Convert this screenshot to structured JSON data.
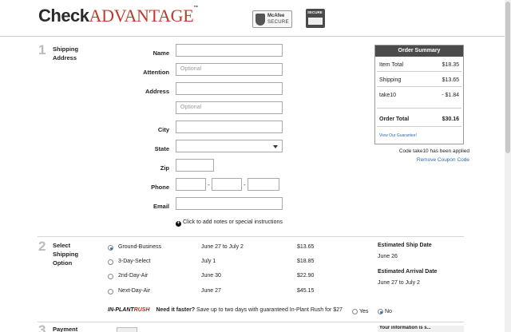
{
  "header": {
    "logo_check": "Check",
    "logo_advantage": "ADVANTAGE",
    "logo_tm": "™",
    "mcafee_line1": "McAfee",
    "mcafee_line2": "SECURE",
    "secure_badge": "SECURE"
  },
  "steps": {
    "s1_num": "1",
    "s1_label_a": "Shipping",
    "s1_label_b": "Address",
    "s2_num": "2",
    "s2_label_a": "Select",
    "s2_label_b": "Shipping",
    "s2_label_c": "Option",
    "s3_num": "3",
    "s3_label": "Payment"
  },
  "form": {
    "name_label": "Name",
    "attention_label": "Attention",
    "attention_placeholder": "Optional",
    "address_label": "Address",
    "address2_placeholder": "Optional",
    "city_label": "City",
    "state_label": "State",
    "zip_label": "Zip",
    "phone_label": "Phone",
    "phone_sep": "-",
    "email_label": "Email",
    "add_notes": "Click to add notes or special instructions"
  },
  "summary": {
    "title": "Order Summary",
    "item_total_label": "Item Total",
    "item_total": "$18.35",
    "shipping_label": "Shipping",
    "shipping": "$13.65",
    "coupon_label": "take10",
    "coupon": "- $1.84",
    "order_total_label": "Order Total",
    "order_total": "$30.16",
    "guarantee_link": "View Our Guarantee!",
    "coupon_msg": "Code take10 has been applied",
    "remove_coupon": "Remove Coupon Code"
  },
  "shipping_options": [
    {
      "method": "Ground-Business",
      "date": "June 27 to July 2",
      "price": "$13.65",
      "selected": true
    },
    {
      "method": "3-Day-Select",
      "date": "July 1",
      "price": "$18.85",
      "selected": false
    },
    {
      "method": "2nd-Day-Air",
      "date": "June 30",
      "price": "$22.90",
      "selected": false
    },
    {
      "method": "Next-Day-Air",
      "date": "June 27",
      "price": "$45.15",
      "selected": false
    }
  ],
  "estimates": {
    "ship_label": "Estimated Ship Date",
    "ship_date": "June 26",
    "arrival_label": "Estimated Arrival Date",
    "arrival_date": "June 27 to July 2"
  },
  "rush": {
    "logo_a": "IN-PLANT",
    "logo_b": "RUSH",
    "question": "Need it faster?",
    "text": "Save up to two days with guaranteed In-Plant Rush for $27",
    "yes": "Yes",
    "no": "No",
    "selected": "No"
  },
  "step3_right": "Your information is s..."
}
